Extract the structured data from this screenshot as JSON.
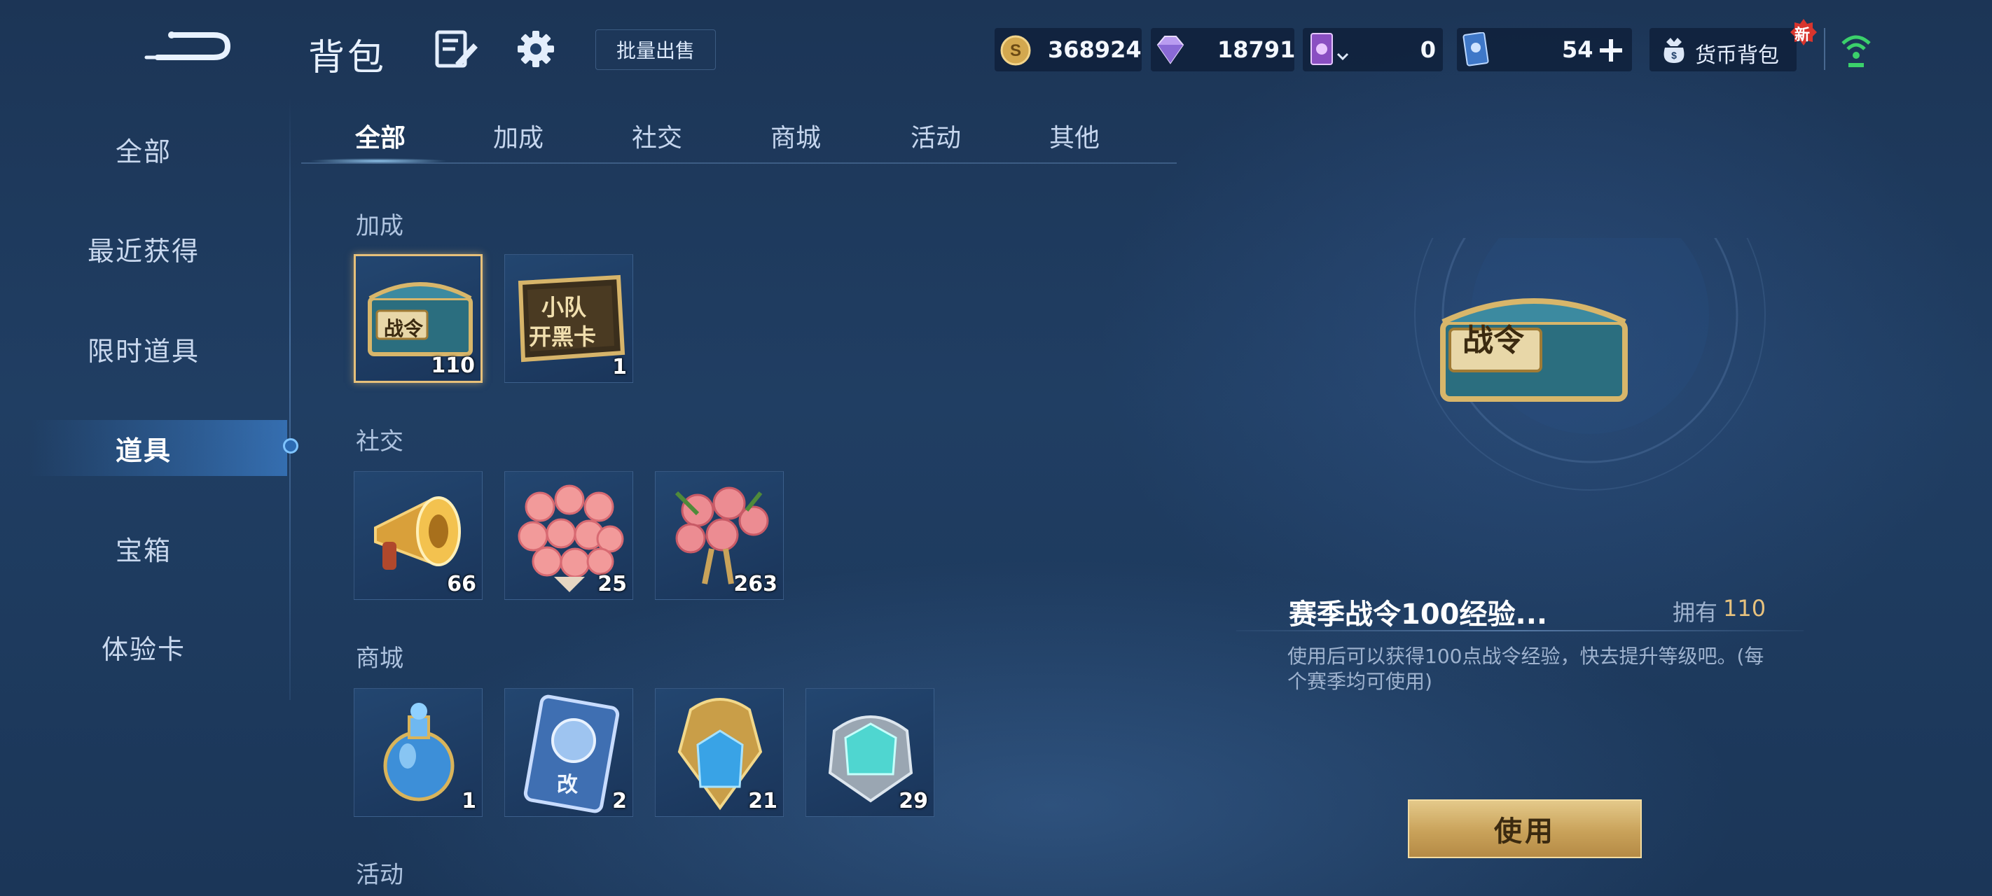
{
  "header": {
    "title": "背包",
    "batch_sell_label": "批量出售",
    "gold_amount": "368924",
    "diamond_amount": "18791",
    "card_a_amount": "0",
    "card_b_amount": "54",
    "money_bag_label": "货币背包",
    "new_badge": "新"
  },
  "sidebar": {
    "items": [
      {
        "label": "全部"
      },
      {
        "label": "最近获得"
      },
      {
        "label": "限时道具"
      },
      {
        "label": "道具"
      },
      {
        "label": "宝箱"
      },
      {
        "label": "体验卡"
      }
    ],
    "active_index": 3
  },
  "tabs": [
    {
      "label": "全部"
    },
    {
      "label": "加成"
    },
    {
      "label": "社交"
    },
    {
      "label": "商城"
    },
    {
      "label": "活动"
    },
    {
      "label": "其他"
    }
  ],
  "sections": [
    {
      "title": "加成",
      "items": [
        {
          "icon": "battle-pass-chest-icon",
          "count": "110",
          "art_text": "战令"
        },
        {
          "icon": "squad-card-icon",
          "count": "1",
          "art_text": "小队",
          "art_text2": "开黑卡"
        }
      ]
    },
    {
      "title": "社交",
      "items": [
        {
          "icon": "megaphone-icon",
          "count": "66"
        },
        {
          "icon": "rose-bouquet-icon",
          "count": "25"
        },
        {
          "icon": "rose-bundle-icon",
          "count": "263"
        }
      ]
    },
    {
      "title": "商城",
      "items": [
        {
          "icon": "potion-bottle-icon",
          "count": "1"
        },
        {
          "icon": "rename-card-icon",
          "count": "2",
          "art_text": "改"
        },
        {
          "icon": "blue-crystal-icon",
          "count": "21"
        },
        {
          "icon": "cyan-crystal-icon",
          "count": "29"
        }
      ]
    },
    {
      "title": "活动",
      "items": []
    }
  ],
  "detail": {
    "chest_text": "战令",
    "name": "赛季战令100经验...",
    "owned_label": "拥有",
    "owned_count": "110",
    "description": "使用后可以获得100点战令经验，快去提升等级吧。(每个赛季均可使用)",
    "use_button": "使用"
  }
}
